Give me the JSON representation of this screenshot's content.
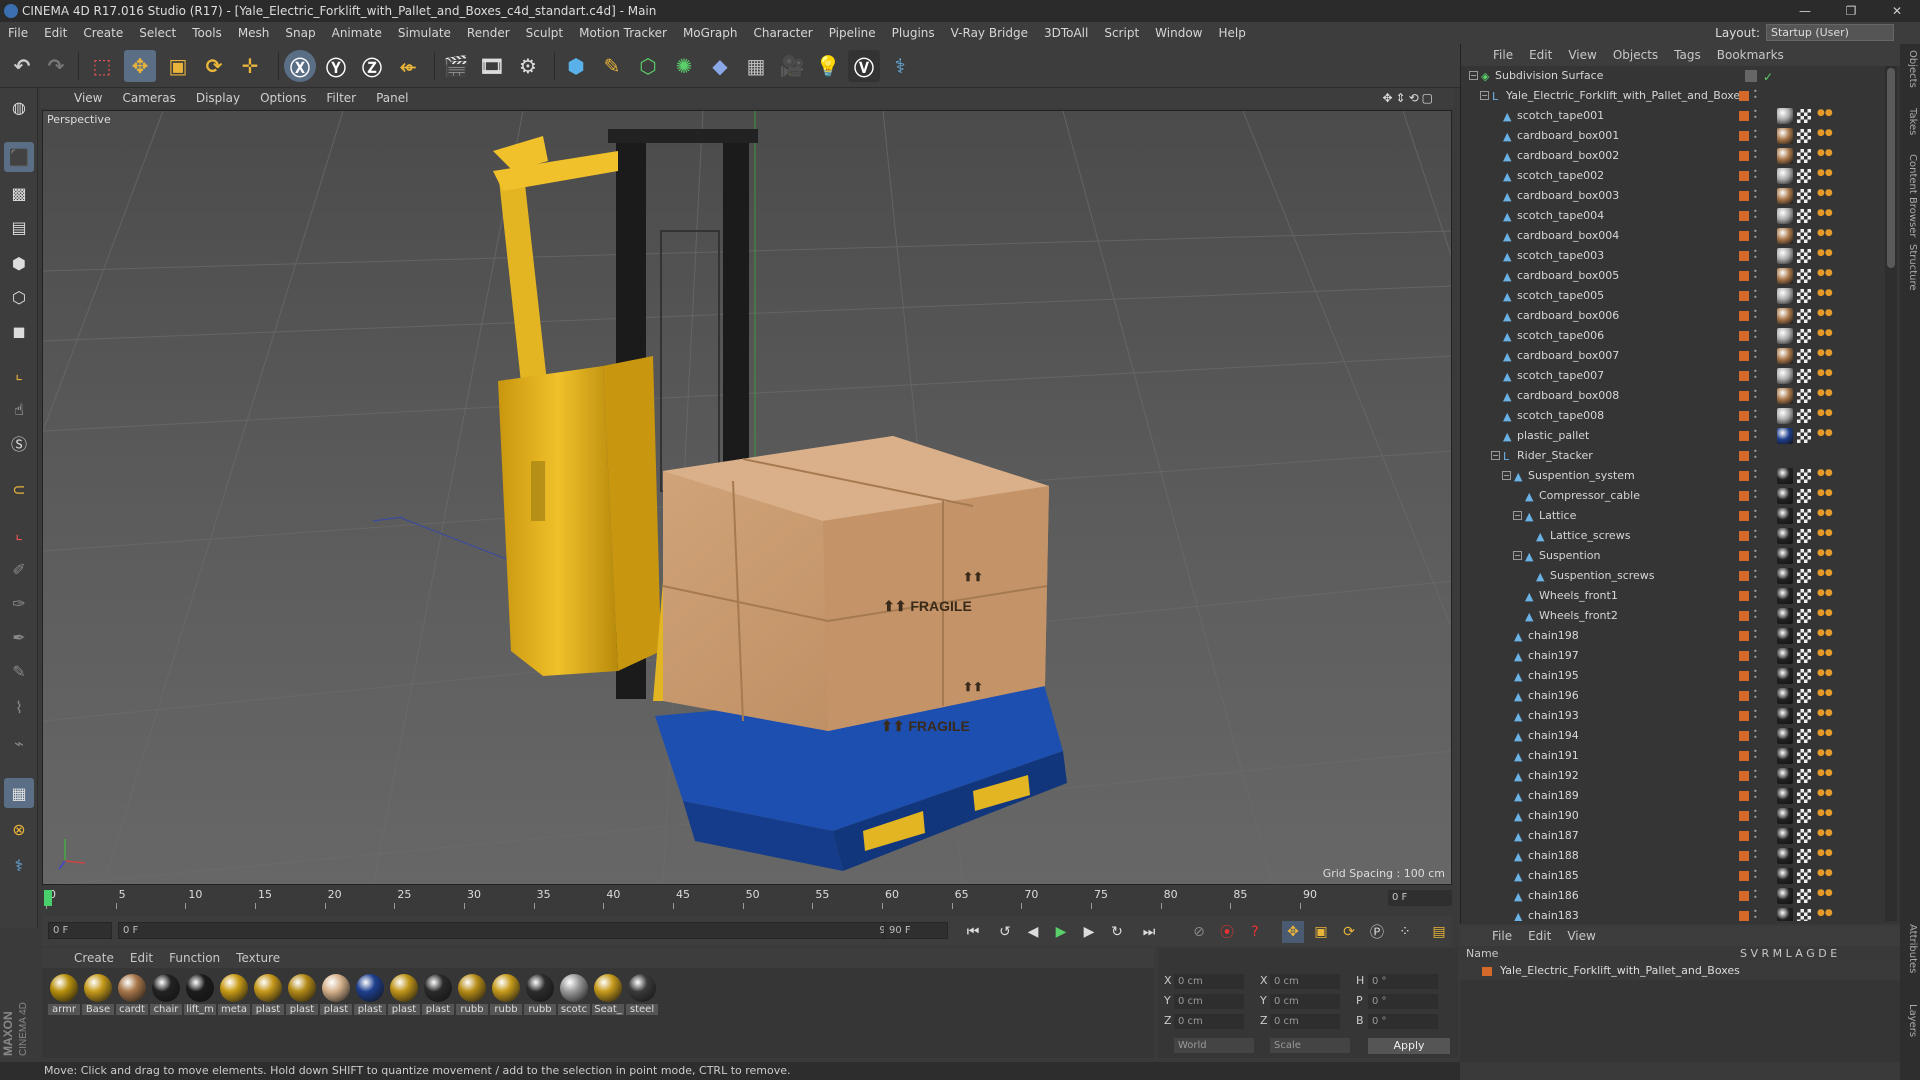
{
  "window": {
    "title": "CINEMA 4D R17.016 Studio (R17) - [Yale_Electric_Forklift_with_Pallet_and_Boxes_c4d_standart.c4d] - Main"
  },
  "menubar": [
    "File",
    "Edit",
    "Create",
    "Select",
    "Tools",
    "Mesh",
    "Snap",
    "Animate",
    "Simulate",
    "Render",
    "Sculpt",
    "Motion Tracker",
    "MoGraph",
    "Character",
    "Pipeline",
    "Plugins",
    "V-Ray Bridge",
    "3DToAll",
    "Script",
    "Window",
    "Help"
  ],
  "layout": {
    "label": "Layout:",
    "value": "Startup (User)"
  },
  "viewport_menu": [
    "View",
    "Cameras",
    "Display",
    "Options",
    "Filter",
    "Panel"
  ],
  "viewport": {
    "name": "Perspective",
    "grid_spacing": "Grid Spacing : 100 cm"
  },
  "timeline": {
    "ticks": [
      "0",
      "5",
      "10",
      "15",
      "20",
      "25",
      "30",
      "35",
      "40",
      "45",
      "50",
      "55",
      "60",
      "65",
      "70",
      "75",
      "80",
      "85",
      "90"
    ],
    "end_frame": "0 F",
    "current": "0 F",
    "range_start": "0 F",
    "range_end": "90 F",
    "max": "90 F"
  },
  "material_menu": [
    "Create",
    "Edit",
    "Function",
    "Texture"
  ],
  "materials": [
    {
      "label": "armr",
      "color": "#b8900c"
    },
    {
      "label": "Base",
      "color": "#c69a1a"
    },
    {
      "label": "cardt",
      "color": "#a8774a"
    },
    {
      "label": "chair",
      "color": "#222222"
    },
    {
      "label": "lift_m",
      "color": "#1c1c1c"
    },
    {
      "label": "meta",
      "color": "#c89b15"
    },
    {
      "label": "plast",
      "color": "#c6981a"
    },
    {
      "label": "plast",
      "color": "#b48a16"
    },
    {
      "label": "plast",
      "color": "#d6b28c"
    },
    {
      "label": "plast",
      "color": "#1e3f8e"
    },
    {
      "label": "plast",
      "color": "#bf9418"
    },
    {
      "label": "plast",
      "color": "#2a2a2a"
    },
    {
      "label": "rubb",
      "color": "#b78d17"
    },
    {
      "label": "rubb",
      "color": "#c69a1a"
    },
    {
      "label": "rubb",
      "color": "#2c2c2c"
    },
    {
      "label": "scotc",
      "color": "#9a9a9a"
    },
    {
      "label": "Seat_",
      "color": "#c69a1a"
    },
    {
      "label": "steel",
      "color": "#3a3a3a"
    }
  ],
  "coords": {
    "x": "0 cm",
    "y": "0 cm",
    "z": "0 cm",
    "sx": "0 cm",
    "sy": "0 cm",
    "sz": "0 cm",
    "h": "0 °",
    "p": "0 °",
    "b": "0 °",
    "world": "World",
    "scale": "Scale",
    "apply": "Apply"
  },
  "status": "Move: Click and drag to move elements. Hold down SHIFT to quantize movement / add to the selection in point mode, CTRL to remove.",
  "object_menu": [
    "File",
    "Edit",
    "View",
    "Objects",
    "Tags",
    "Bookmarks"
  ],
  "objects": [
    {
      "label": "Subdivision Surface",
      "indent": 0,
      "exp": "-",
      "tagcolor": ""
    },
    {
      "label": "Yale_Electric_Forklift_with_Pallet_and_Boxes",
      "indent": 1,
      "exp": "-",
      "tagcolor": ""
    },
    {
      "label": "scotch_tape001",
      "indent": 2,
      "exp": "",
      "tagcolor": "#aaaaaa"
    },
    {
      "label": "cardboard_box001",
      "indent": 2,
      "exp": "",
      "tagcolor": "#a8774a"
    },
    {
      "label": "cardboard_box002",
      "indent": 2,
      "exp": "",
      "tagcolor": "#a8774a"
    },
    {
      "label": "scotch_tape002",
      "indent": 2,
      "exp": "",
      "tagcolor": "#aaaaaa"
    },
    {
      "label": "cardboard_box003",
      "indent": 2,
      "exp": "",
      "tagcolor": "#a8774a"
    },
    {
      "label": "scotch_tape004",
      "indent": 2,
      "exp": "",
      "tagcolor": "#aaaaaa"
    },
    {
      "label": "cardboard_box004",
      "indent": 2,
      "exp": "",
      "tagcolor": "#a8774a"
    },
    {
      "label": "scotch_tape003",
      "indent": 2,
      "exp": "",
      "tagcolor": "#aaaaaa"
    },
    {
      "label": "cardboard_box005",
      "indent": 2,
      "exp": "",
      "tagcolor": "#a8774a"
    },
    {
      "label": "scotch_tape005",
      "indent": 2,
      "exp": "",
      "tagcolor": "#aaaaaa"
    },
    {
      "label": "cardboard_box006",
      "indent": 2,
      "exp": "",
      "tagcolor": "#a8774a"
    },
    {
      "label": "scotch_tape006",
      "indent": 2,
      "exp": "",
      "tagcolor": "#aaaaaa"
    },
    {
      "label": "cardboard_box007",
      "indent": 2,
      "exp": "",
      "tagcolor": "#a8774a"
    },
    {
      "label": "scotch_tape007",
      "indent": 2,
      "exp": "",
      "tagcolor": "#aaaaaa"
    },
    {
      "label": "cardboard_box008",
      "indent": 2,
      "exp": "",
      "tagcolor": "#a8774a"
    },
    {
      "label": "scotch_tape008",
      "indent": 2,
      "exp": "",
      "tagcolor": "#aaaaaa"
    },
    {
      "label": "plastic_pallet",
      "indent": 2,
      "exp": "",
      "tagcolor": "#1e3f8e"
    },
    {
      "label": "Rider_Stacker",
      "indent": 2,
      "exp": "-",
      "tagcolor": ""
    },
    {
      "label": "Suspention_system",
      "indent": 3,
      "exp": "-",
      "tagcolor": "#222222"
    },
    {
      "label": "Compressor_cable",
      "indent": 4,
      "exp": "",
      "tagcolor": "#222222"
    },
    {
      "label": "Lattice",
      "indent": 4,
      "exp": "-",
      "tagcolor": "#222222"
    },
    {
      "label": "Lattice_screws",
      "indent": 5,
      "exp": "",
      "tagcolor": "#222222"
    },
    {
      "label": "Suspention",
      "indent": 4,
      "exp": "-",
      "tagcolor": "#222222"
    },
    {
      "label": "Suspention_screws",
      "indent": 5,
      "exp": "",
      "tagcolor": "#222222"
    },
    {
      "label": "Wheels_front1",
      "indent": 4,
      "exp": "",
      "tagcolor": "#222222"
    },
    {
      "label": "Wheels_front2",
      "indent": 4,
      "exp": "",
      "tagcolor": "#222222"
    },
    {
      "label": "chain198",
      "indent": 3,
      "exp": "",
      "tagcolor": "#222222"
    },
    {
      "label": "chain197",
      "indent": 3,
      "exp": "",
      "tagcolor": "#222222"
    },
    {
      "label": "chain195",
      "indent": 3,
      "exp": "",
      "tagcolor": "#222222"
    },
    {
      "label": "chain196",
      "indent": 3,
      "exp": "",
      "tagcolor": "#222222"
    },
    {
      "label": "chain193",
      "indent": 3,
      "exp": "",
      "tagcolor": "#222222"
    },
    {
      "label": "chain194",
      "indent": 3,
      "exp": "",
      "tagcolor": "#222222"
    },
    {
      "label": "chain191",
      "indent": 3,
      "exp": "",
      "tagcolor": "#222222"
    },
    {
      "label": "chain192",
      "indent": 3,
      "exp": "",
      "tagcolor": "#222222"
    },
    {
      "label": "chain189",
      "indent": 3,
      "exp": "",
      "tagcolor": "#222222"
    },
    {
      "label": "chain190",
      "indent": 3,
      "exp": "",
      "tagcolor": "#222222"
    },
    {
      "label": "chain187",
      "indent": 3,
      "exp": "",
      "tagcolor": "#222222"
    },
    {
      "label": "chain188",
      "indent": 3,
      "exp": "",
      "tagcolor": "#222222"
    },
    {
      "label": "chain185",
      "indent": 3,
      "exp": "",
      "tagcolor": "#222222"
    },
    {
      "label": "chain186",
      "indent": 3,
      "exp": "",
      "tagcolor": "#222222"
    },
    {
      "label": "chain183",
      "indent": 3,
      "exp": "",
      "tagcolor": "#222222"
    }
  ],
  "layers_menu": [
    "File",
    "Edit",
    "View"
  ],
  "layers_header": {
    "name": "Name",
    "cols": "S  V  R  M  L  A  G  D  E"
  },
  "layers_row": "Yale_Electric_Forklift_with_Pallet_and_Boxes",
  "side_tabs": [
    "Objects",
    "Takes",
    "Content Browser",
    "Structure",
    "Attributes",
    "Layers"
  ],
  "maxon": "MAXON CINEMA 4D",
  "colors": {
    "accent": "#5a6e86",
    "orange": "#d4692a",
    "forklift": "#e3b522",
    "pallet": "#1d4fb0"
  }
}
